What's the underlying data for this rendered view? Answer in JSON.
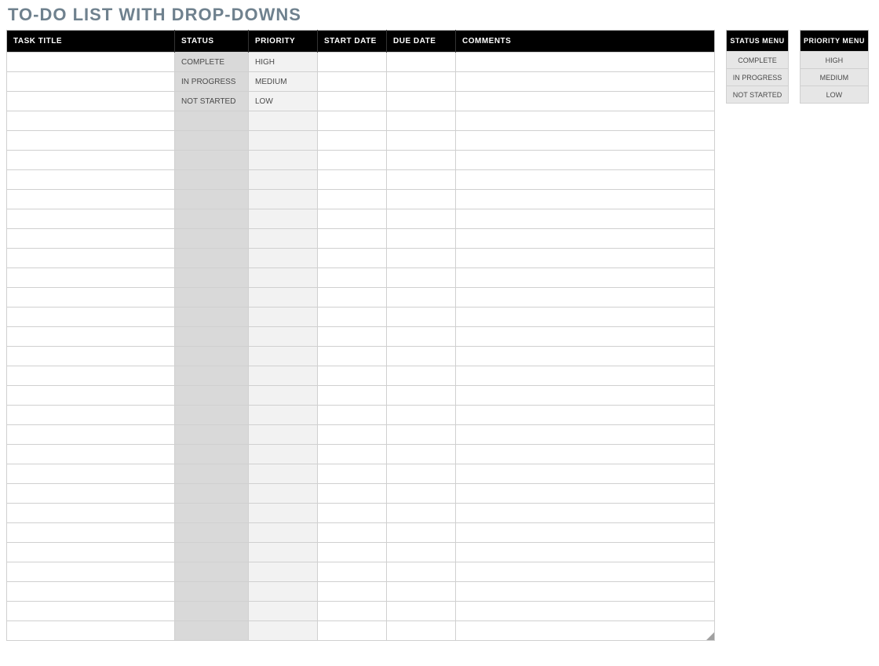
{
  "title": "TO-DO LIST WITH DROP-DOWNS",
  "columns": {
    "task": "TASK TITLE",
    "status": "STATUS",
    "priority": "PRIORITY",
    "start": "START DATE",
    "due": "DUE DATE",
    "comments": "COMMENTS"
  },
  "rows": [
    {
      "task": "",
      "status": "COMPLETE",
      "priority": "HIGH",
      "start": "",
      "due": "",
      "comments": ""
    },
    {
      "task": "",
      "status": "IN PROGRESS",
      "priority": "MEDIUM",
      "start": "",
      "due": "",
      "comments": ""
    },
    {
      "task": "",
      "status": "NOT STARTED",
      "priority": "LOW",
      "start": "",
      "due": "",
      "comments": ""
    },
    {
      "task": "",
      "status": "",
      "priority": "",
      "start": "",
      "due": "",
      "comments": ""
    },
    {
      "task": "",
      "status": "",
      "priority": "",
      "start": "",
      "due": "",
      "comments": ""
    },
    {
      "task": "",
      "status": "",
      "priority": "",
      "start": "",
      "due": "",
      "comments": ""
    },
    {
      "task": "",
      "status": "",
      "priority": "",
      "start": "",
      "due": "",
      "comments": ""
    },
    {
      "task": "",
      "status": "",
      "priority": "",
      "start": "",
      "due": "",
      "comments": ""
    },
    {
      "task": "",
      "status": "",
      "priority": "",
      "start": "",
      "due": "",
      "comments": ""
    },
    {
      "task": "",
      "status": "",
      "priority": "",
      "start": "",
      "due": "",
      "comments": ""
    },
    {
      "task": "",
      "status": "",
      "priority": "",
      "start": "",
      "due": "",
      "comments": ""
    },
    {
      "task": "",
      "status": "",
      "priority": "",
      "start": "",
      "due": "",
      "comments": ""
    },
    {
      "task": "",
      "status": "",
      "priority": "",
      "start": "",
      "due": "",
      "comments": ""
    },
    {
      "task": "",
      "status": "",
      "priority": "",
      "start": "",
      "due": "",
      "comments": ""
    },
    {
      "task": "",
      "status": "",
      "priority": "",
      "start": "",
      "due": "",
      "comments": ""
    },
    {
      "task": "",
      "status": "",
      "priority": "",
      "start": "",
      "due": "",
      "comments": ""
    },
    {
      "task": "",
      "status": "",
      "priority": "",
      "start": "",
      "due": "",
      "comments": ""
    },
    {
      "task": "",
      "status": "",
      "priority": "",
      "start": "",
      "due": "",
      "comments": ""
    },
    {
      "task": "",
      "status": "",
      "priority": "",
      "start": "",
      "due": "",
      "comments": ""
    },
    {
      "task": "",
      "status": "",
      "priority": "",
      "start": "",
      "due": "",
      "comments": ""
    },
    {
      "task": "",
      "status": "",
      "priority": "",
      "start": "",
      "due": "",
      "comments": ""
    },
    {
      "task": "",
      "status": "",
      "priority": "",
      "start": "",
      "due": "",
      "comments": ""
    },
    {
      "task": "",
      "status": "",
      "priority": "",
      "start": "",
      "due": "",
      "comments": ""
    },
    {
      "task": "",
      "status": "",
      "priority": "",
      "start": "",
      "due": "",
      "comments": ""
    },
    {
      "task": "",
      "status": "",
      "priority": "",
      "start": "",
      "due": "",
      "comments": ""
    },
    {
      "task": "",
      "status": "",
      "priority": "",
      "start": "",
      "due": "",
      "comments": ""
    },
    {
      "task": "",
      "status": "",
      "priority": "",
      "start": "",
      "due": "",
      "comments": ""
    },
    {
      "task": "",
      "status": "",
      "priority": "",
      "start": "",
      "due": "",
      "comments": ""
    },
    {
      "task": "",
      "status": "",
      "priority": "",
      "start": "",
      "due": "",
      "comments": ""
    },
    {
      "task": "",
      "status": "",
      "priority": "",
      "start": "",
      "due": "",
      "comments": ""
    }
  ],
  "status_menu": {
    "header": "STATUS MENU",
    "items": [
      "COMPLETE",
      "IN PROGRESS",
      "NOT STARTED"
    ]
  },
  "priority_menu": {
    "header": "PRIORITY MENU",
    "items": [
      "HIGH",
      "MEDIUM",
      "LOW"
    ]
  }
}
